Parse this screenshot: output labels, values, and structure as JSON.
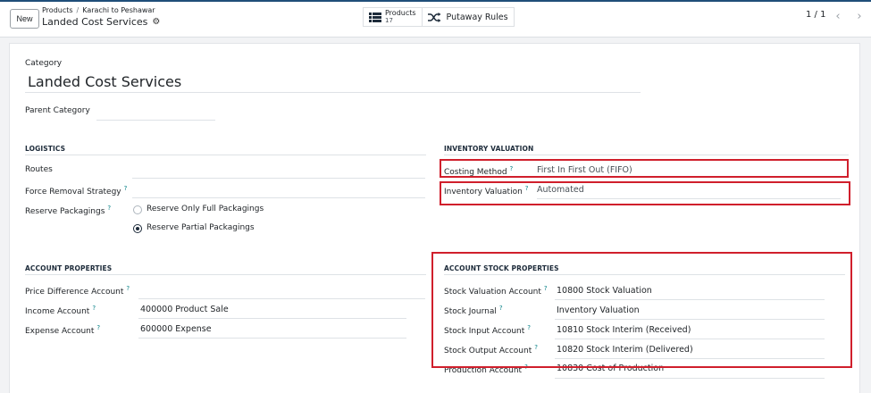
{
  "breadcrumb": {
    "parent": "Products",
    "current": "Karachi to Peshawar"
  },
  "record_title": "Landed Cost Services",
  "new_button": "New",
  "smart_buttons": [
    {
      "label": "Products",
      "count": "17",
      "icon": "list-icon"
    },
    {
      "label": "Putaway Rules",
      "icon": "shuffle-icon"
    }
  ],
  "pager": {
    "value": "1 / 1"
  },
  "form": {
    "category_label": "Category",
    "category_value": "Landed Cost Services",
    "parent_category_label": "Parent Category",
    "parent_category_value": "",
    "logistics": {
      "title": "LOGISTICS",
      "routes_label": "Routes",
      "force_removal_label": "Force Removal Strategy",
      "reserve_packagings_label": "Reserve Packagings",
      "reserve_options": [
        {
          "label": "Reserve Only Full Packagings",
          "selected": false
        },
        {
          "label": "Reserve Partial Packagings",
          "selected": true
        }
      ]
    },
    "inventory_valuation": {
      "title": "INVENTORY VALUATION",
      "costing_method_label": "Costing Method",
      "costing_method_value": "First In First Out (FIFO)",
      "inventory_valuation_label": "Inventory Valuation",
      "inventory_valuation_value": "Automated"
    },
    "account_properties": {
      "title": "ACCOUNT PROPERTIES",
      "price_difference_label": "Price Difference Account",
      "price_difference_value": "",
      "income_label": "Income Account",
      "income_value": "400000 Product Sale",
      "expense_label": "Expense Account",
      "expense_value": "600000 Expense"
    },
    "account_stock_properties": {
      "title": "ACCOUNT STOCK PROPERTIES",
      "stock_valuation_label": "Stock Valuation Account",
      "stock_valuation_value": "10800 Stock Valuation",
      "stock_journal_label": "Stock Journal",
      "stock_journal_value": "Inventory Valuation",
      "stock_input_label": "Stock Input Account",
      "stock_input_value": "10810 Stock Interim (Received)",
      "stock_output_label": "Stock Output Account",
      "stock_output_value": "10820 Stock Interim (Delivered)",
      "production_label": "Production Account",
      "production_value": "10830 Cost of Production"
    },
    "help_mark": "?"
  },
  "colors": {
    "highlight": "#d01f2c",
    "help": "#017e84",
    "section": "#1d2b3a"
  }
}
